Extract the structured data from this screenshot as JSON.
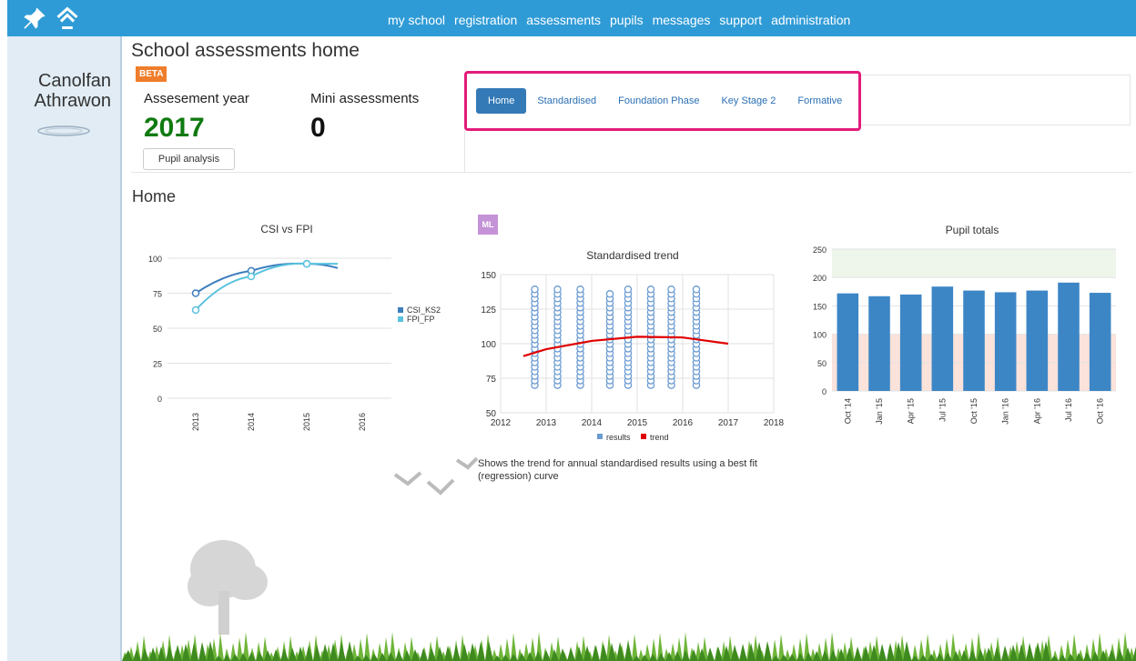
{
  "sidebar": {
    "pin_icon": "pin-icon",
    "home_icon": "home-icon",
    "brand": "Canolfan Athrawon"
  },
  "nav": {
    "items": [
      "my school",
      "registration",
      "assessments",
      "pupils",
      "messages",
      "support",
      "administration"
    ]
  },
  "page_title": "School assessments home",
  "beta_badge": "BETA",
  "assessment_year": {
    "label": "Assesement year",
    "value": "2017"
  },
  "mini_assessments": {
    "label": "Mini assessments",
    "value": "0"
  },
  "pupil_analysis_button": "Pupil analysis",
  "tabs": [
    "Home",
    "Standardised",
    "Foundation Phase",
    "Key Stage 2",
    "Formative"
  ],
  "active_tab": "Home",
  "section_heading": "Home",
  "ml_badge": "ML",
  "trend_description": "Shows the trend for annual standardised results using a best fit (regression) curve",
  "colors": {
    "nav_bar": "#2f9bd6",
    "sidebar": "#e1ecf4",
    "highlight": "#e31b7a",
    "year_green": "#107a10",
    "bar_blue": "#3d86c6"
  },
  "chart_data": [
    {
      "type": "line",
      "title": "CSI vs FPI",
      "x": [
        "2013",
        "2014",
        "2015",
        "2016"
      ],
      "ylim": [
        0,
        100
      ],
      "yticks": [
        0,
        25,
        50,
        75,
        100
      ],
      "series": [
        {
          "name": "CSI_KS2",
          "color": "#3d7ebd",
          "points": [
            [
              2013,
              75
            ],
            [
              2014,
              91
            ],
            [
              2015,
              96
            ]
          ]
        },
        {
          "name": "FPI_FP",
          "color": "#5bc2de",
          "points": [
            [
              2013,
              63
            ],
            [
              2014,
              87
            ],
            [
              2015,
              96
            ]
          ]
        }
      ],
      "legend": "right",
      "grid": true
    },
    {
      "type": "scatter",
      "title": "Standardised trend",
      "xlim": [
        2012,
        2018
      ],
      "xticks": [
        2012,
        2013,
        2014,
        2015,
        2016,
        2017,
        2018
      ],
      "ylim": [
        50,
        150
      ],
      "yticks": [
        50,
        75,
        100,
        125,
        150
      ],
      "results_columns": [
        {
          "x": 2012.75,
          "min": 70,
          "max": 140
        },
        {
          "x": 2013.25,
          "min": 70,
          "max": 140
        },
        {
          "x": 2013.75,
          "min": 70,
          "max": 140
        },
        {
          "x": 2014.4,
          "min": 70,
          "max": 136
        },
        {
          "x": 2014.8,
          "min": 70,
          "max": 140
        },
        {
          "x": 2015.3,
          "min": 70,
          "max": 140
        },
        {
          "x": 2015.75,
          "min": 70,
          "max": 140
        },
        {
          "x": 2016.3,
          "min": 70,
          "max": 140
        }
      ],
      "trend": [
        [
          2012.5,
          91
        ],
        [
          2013,
          96
        ],
        [
          2014,
          102
        ],
        [
          2015,
          105
        ],
        [
          2016,
          104.5
        ],
        [
          2017,
          100
        ]
      ],
      "legend": [
        {
          "name": "results",
          "color": "#6b9bd1"
        },
        {
          "name": "trend",
          "color": "#e00000"
        }
      ],
      "grid": true
    },
    {
      "type": "bar",
      "title": "Pupil totals",
      "categories": [
        "Oct '14",
        "Jan '15",
        "Apr '15",
        "Jul '15",
        "Oct '15",
        "Jan '16",
        "Apr '16",
        "Jul '16",
        "Oct '16"
      ],
      "values": [
        172,
        167,
        170,
        184,
        177,
        174,
        177,
        191,
        173
      ],
      "ylim": [
        0,
        250
      ],
      "yticks": [
        0,
        50,
        100,
        150,
        200,
        250
      ],
      "bands": [
        {
          "from": 0,
          "to": 100,
          "color": "#fbe2da"
        },
        {
          "from": 200,
          "to": 250,
          "color": "#eef6ec"
        }
      ],
      "grid": true
    }
  ]
}
